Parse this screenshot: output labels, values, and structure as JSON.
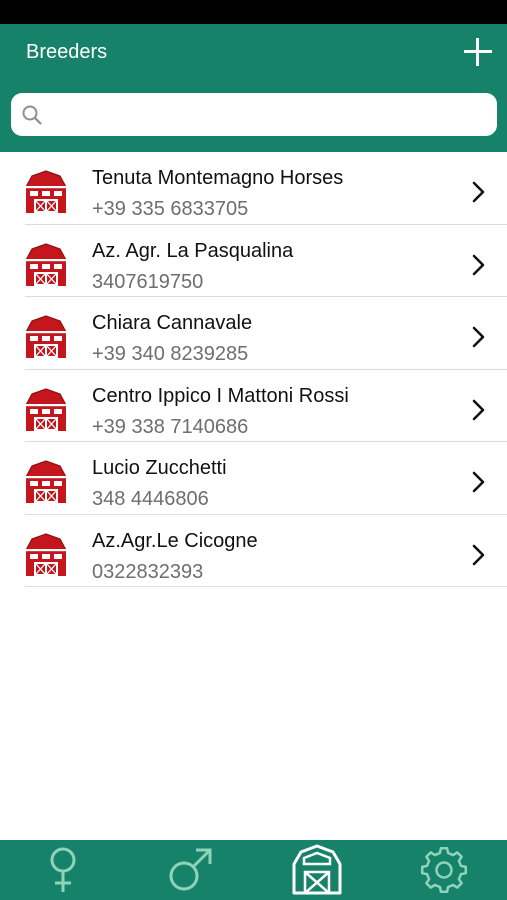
{
  "header": {
    "title": "Breeders",
    "add_icon": "plus-icon"
  },
  "search": {
    "value": "",
    "placeholder": "",
    "icon": "search-icon"
  },
  "breeders": [
    {
      "name": "Tenuta Montemagno Horses",
      "phone": "+39 335 6833705",
      "icon": "barn-icon"
    },
    {
      "name": "Az. Agr. La Pasqualina",
      "phone": "3407619750",
      "icon": "barn-icon"
    },
    {
      "name": "Chiara Cannavale",
      "phone": "+39 340 8239285",
      "icon": "barn-icon"
    },
    {
      "name": "Centro Ippico I Mattoni Rossi",
      "phone": "+39 338 7140686",
      "icon": "barn-icon"
    },
    {
      "name": "Lucio Zucchetti",
      "phone": "348 4446806",
      "icon": "barn-icon"
    },
    {
      "name": "Az.Agr.Le Cicogne",
      "phone": "0322832393",
      "icon": "barn-icon"
    }
  ],
  "tabs": [
    {
      "icon": "female-icon",
      "selected": false
    },
    {
      "icon": "male-icon",
      "selected": false
    },
    {
      "icon": "barn-icon",
      "selected": true
    },
    {
      "icon": "gear-icon",
      "selected": false
    }
  ],
  "colors": {
    "primary": "#17826a",
    "barn_red": "#c4161c",
    "tab_icon_inactive": "#8fd3b9",
    "tab_icon_active": "#ffffff"
  }
}
